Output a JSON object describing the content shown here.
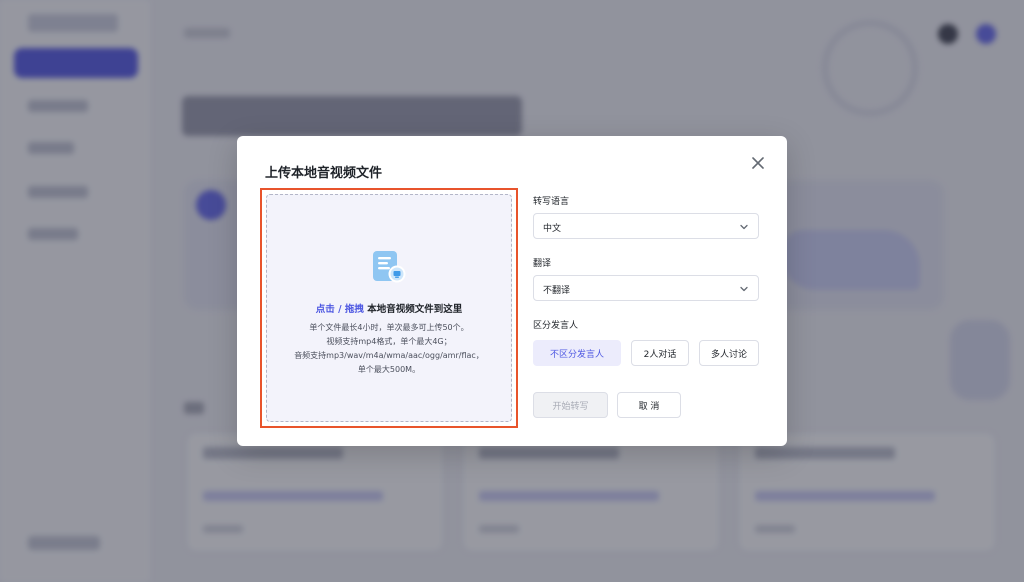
{
  "dialog": {
    "title": "上传本地音视频文件",
    "upload": {
      "link_text": "点击 / 拖拽",
      "main_text": " 本地音视频文件到这里",
      "desc_lines": [
        "单个文件最长4小时，单次最多可上传50个。",
        "视频支持mp4格式，单个最大4G；",
        "音频支持mp3/wav/m4a/wma/aac/ogg/amr/flac，",
        "单个最大500M。"
      ]
    },
    "transcribe_language": {
      "label": "转写语言",
      "value": "中文"
    },
    "translate": {
      "label": "翻译",
      "value": "不翻译"
    },
    "speaker": {
      "label": "区分发言人",
      "options": [
        "不区分发言人",
        "2人对话",
        "多人讨论"
      ],
      "selected": "不区分发言人"
    },
    "start_button": "开始转写",
    "cancel_button": "取 消"
  },
  "colors": {
    "accent": "#4e58e2",
    "highlight_border": "#e8542c",
    "overlay": "rgba(24,26,40,0.42)"
  },
  "icons": [
    "close-icon",
    "file-upload-icon",
    "chevron-down-icon"
  ]
}
